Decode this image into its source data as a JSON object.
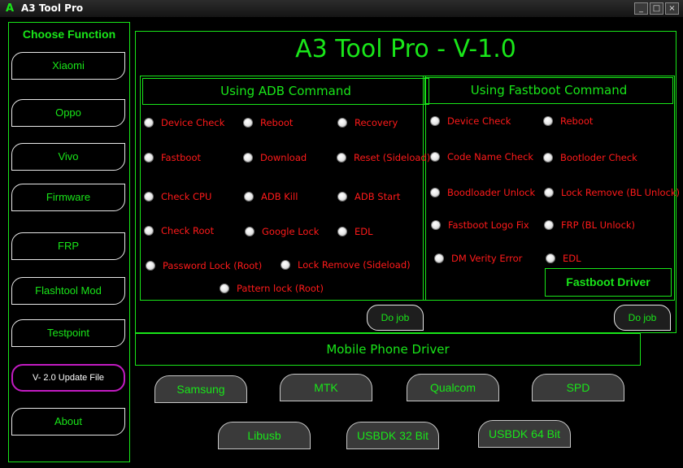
{
  "window": {
    "title": "A3 Tool Pro",
    "icon": "A",
    "minimize": "_",
    "maximize": "□",
    "close": "×"
  },
  "sidebar": {
    "heading": "Choose Function",
    "items": [
      "Xiaomi",
      "Oppo",
      "Vivo",
      "Firmware",
      "FRP",
      "Flashtool Mod",
      "Testpoint",
      "V- 2.0 Update File",
      "About"
    ]
  },
  "main": {
    "title": "A3 Tool Pro - V-1.0"
  },
  "adb": {
    "heading": "Using ADB Command",
    "options": [
      "Device Check",
      "Reboot",
      "Recovery",
      "Fastboot",
      "Download",
      "Reset (Sideload)",
      "Check CPU",
      "ADB Kill",
      "ADB Start",
      "Check Root",
      "Google Lock",
      "EDL",
      "Password Lock (Root)",
      "Lock Remove (Sideload)",
      "Pattern lock (Root)"
    ],
    "do_job": "Do job"
  },
  "fastboot": {
    "heading": "Using Fastboot Command",
    "options": [
      "Device Check",
      "Reboot",
      "Code Name Check",
      "Bootloder Check",
      "Boodloader Unlock",
      "Lock Remove (BL Unlock)",
      "Fastboot Logo Fix",
      "FRP (BL Unlock)",
      "DM Verity Error",
      "EDL"
    ],
    "driver_button": "Fastboot Driver",
    "do_job": "Do job"
  },
  "drivers": {
    "heading": "Mobile Phone Driver",
    "buttons": [
      "Samsung",
      "MTK",
      "Qualcom",
      "SPD",
      "Libusb",
      "USBDK 32 Bit",
      "USBDK 64 Bit"
    ]
  },
  "colors": {
    "accent_green": "#19e619",
    "option_red": "#ff1a1a",
    "update_border": "#c21bc2",
    "background": "#000000"
  }
}
